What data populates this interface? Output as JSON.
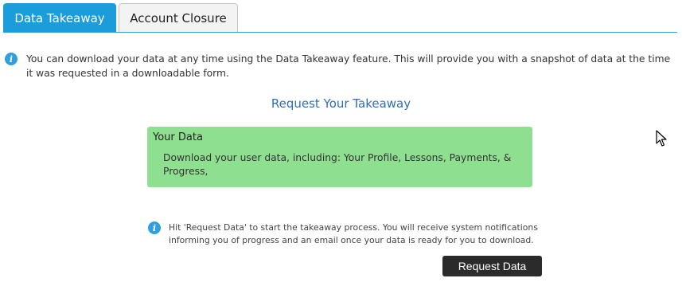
{
  "tabs": [
    {
      "label": "Data Takeaway",
      "active": true
    },
    {
      "label": "Account Closure",
      "active": false
    }
  ],
  "intro": {
    "icon": "info-icon",
    "text": "You can download your data at any time using the Data Takeaway feature. This will provide you with a snapshot of data at the time it was requested in a downloadable form."
  },
  "heading": "Request Your Takeaway",
  "data_card": {
    "title": "Your Data",
    "description": "Download your user data, including: Your Profile, Lessons, Payments, & Progress,"
  },
  "note": {
    "icon": "info-icon",
    "text": "Hit 'Request Data' to start the takeaway process. You will receive system notifications informing you of progress and an email once your data is ready for you to download."
  },
  "request_button": {
    "label": "Request Data"
  },
  "colors": {
    "accent": "#1b9ddb",
    "heading": "#2f6eb5",
    "card_bg": "#8fdf91",
    "button_bg": "#2b2b2b"
  }
}
